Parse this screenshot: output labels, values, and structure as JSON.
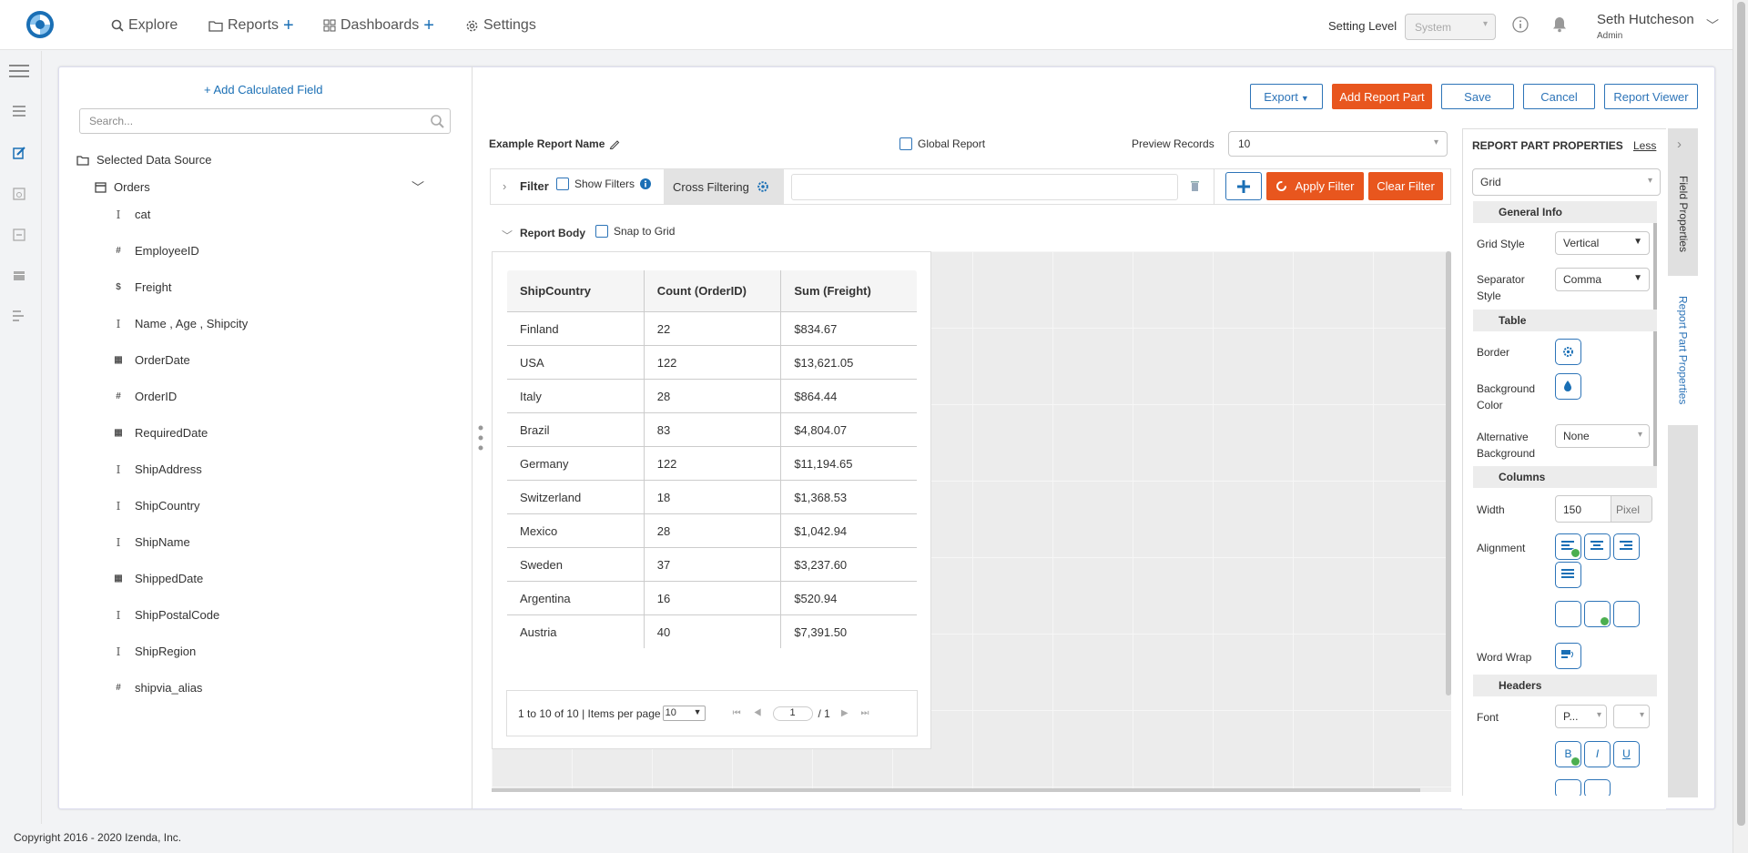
{
  "nav": {
    "explore": "Explore",
    "reports": "Reports",
    "dashboards": "Dashboards",
    "settings": "Settings",
    "plus": "+"
  },
  "header": {
    "setting_level_label": "Setting Level",
    "setting_level_value": "System",
    "user_name": "Seth Hutcheson",
    "user_role": "Admin"
  },
  "footer": {
    "copyright": "Copyright 2016 - 2020 Izenda, Inc."
  },
  "left_panel": {
    "add_calc_field": "+ Add Calculated Field",
    "search_placeholder": "Search...",
    "data_source_label": "Selected Data Source",
    "table_name": "Orders",
    "fields": [
      {
        "type": "I",
        "name": "cat"
      },
      {
        "type": "#",
        "name": "EmployeeID"
      },
      {
        "type": "$",
        "name": "Freight"
      },
      {
        "type": "I",
        "name": "Name , Age , Shipcity"
      },
      {
        "type": "date",
        "name": "OrderDate"
      },
      {
        "type": "#",
        "name": "OrderID"
      },
      {
        "type": "date",
        "name": "RequiredDate"
      },
      {
        "type": "I",
        "name": "ShipAddress"
      },
      {
        "type": "I",
        "name": "ShipCountry"
      },
      {
        "type": "I",
        "name": "ShipName"
      },
      {
        "type": "date",
        "name": "ShippedDate"
      },
      {
        "type": "I",
        "name": "ShipPostalCode"
      },
      {
        "type": "I",
        "name": "ShipRegion"
      },
      {
        "type": "#",
        "name": "shipvia_alias"
      }
    ]
  },
  "toolbar": {
    "export": "Export",
    "add_report_part": "Add Report Part",
    "save": "Save",
    "cancel": "Cancel",
    "report_viewer": "Report Viewer"
  },
  "report": {
    "name": "Example Report Name",
    "global_report": "Global Report",
    "preview_records_label": "Preview Records",
    "preview_records_value": "10"
  },
  "filter": {
    "label": "Filter",
    "show_filters": "Show Filters",
    "cross_filtering": "Cross Filtering",
    "apply": "Apply Filter",
    "clear": "Clear Filter"
  },
  "body": {
    "label": "Report Body",
    "snap_to_grid": "Snap to Grid"
  },
  "grid": {
    "headers": [
      "ShipCountry",
      "Count (OrderID)",
      "Sum (Freight)"
    ],
    "rows": [
      [
        "Finland",
        "22",
        "$834.67"
      ],
      [
        "USA",
        "122",
        "$13,621.05"
      ],
      [
        "Italy",
        "28",
        "$864.44"
      ],
      [
        "Brazil",
        "83",
        "$4,804.07"
      ],
      [
        "Germany",
        "122",
        "$11,194.65"
      ],
      [
        "Switzerland",
        "18",
        "$1,368.53"
      ],
      [
        "Mexico",
        "28",
        "$1,042.94"
      ],
      [
        "Sweden",
        "37",
        "$3,237.60"
      ],
      [
        "Argentina",
        "16",
        "$520.94"
      ],
      [
        "Austria",
        "40",
        "$7,391.50"
      ]
    ]
  },
  "pager": {
    "range": "1 to 10 of 10",
    "items_per_page": "| Items per page",
    "per_page_value": "10",
    "page_value": "1",
    "page_total": "/ 1"
  },
  "properties": {
    "title": "REPORT PART PROPERTIES",
    "less": "Less",
    "part_type": "Grid",
    "sections": {
      "general": "General Info",
      "table": "Table",
      "columns": "Columns",
      "headers": "Headers"
    },
    "grid_style_label": "Grid Style",
    "grid_style_value": "Vertical",
    "separator_label": "Separator Style",
    "separator_value": "Comma",
    "border_label": "Border",
    "bg_color_label": "Background Color",
    "alt_bg_label": "Alternative Background",
    "alt_bg_value": "None",
    "width_label": "Width",
    "width_value": "150",
    "width_unit": "Pixel",
    "alignment_label": "Alignment",
    "word_wrap_label": "Word Wrap",
    "font_label": "Font",
    "font_value": "P...",
    "bold": "B",
    "italic": "I",
    "underline": "U"
  },
  "vtabs": {
    "field_properties": "Field Properties",
    "report_part_properties": "Report Part Properties"
  }
}
